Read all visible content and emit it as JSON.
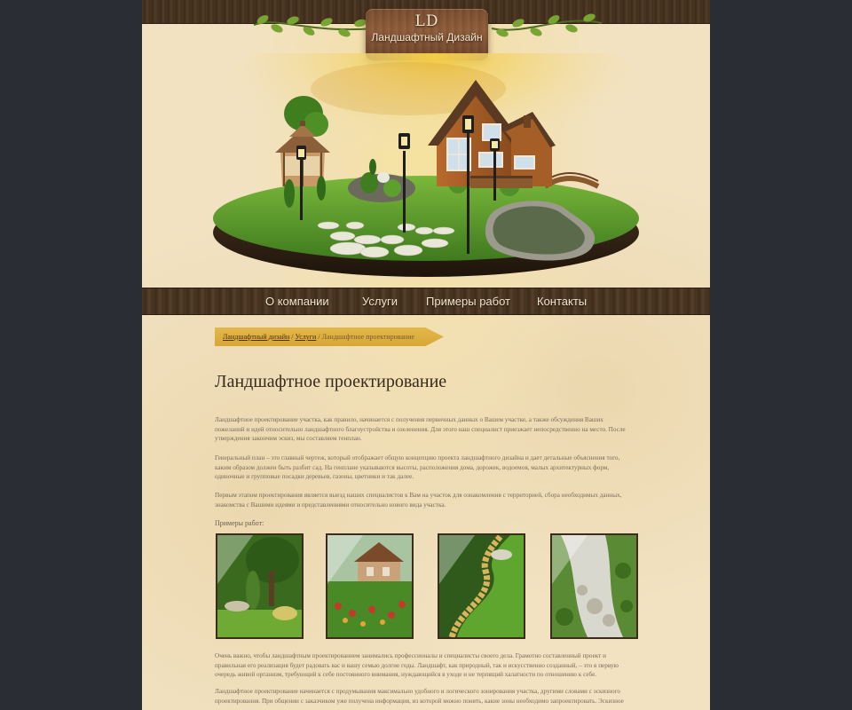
{
  "logo": {
    "mark": "LD",
    "text": "Ландшафтный Дизайн"
  },
  "nav": {
    "about": "О компании",
    "services": "Услуги",
    "works": "Примеры работ",
    "contacts": "Контакты"
  },
  "breadcrumb": {
    "home": "Ландшафтный дизайн",
    "services": "Услуги",
    "separator": "/",
    "current": "Ландшафтное проектирование"
  },
  "main": {
    "title": "Ландшафтное проектирование",
    "paragraphs": [
      "Ландшафтное проектирование участка, как правило, начинается с получения первичных данных о Вашем участке, а также обсуждения Ваших пожеланий и идей относительно ландшафтного благоустройства и озеленения. Для этого наш специалист приезжает непосредственно на место. После утверждения закончим эскиз, мы составляем генплан.",
      "Генеральный план – это главный чертеж, который отображает общую концепцию проекта ландшафтного дизайна и дает детальные объяснения того, каким образом должен быть разбит сад. На генплане указываются высоты, расположения дома, дорожек, водоемов, малых архитектурных форм, одиночные и групповые посадки деревьев, газоны, цветники и так далее.",
      "Первым этапом проектирования является выезд наших специалистов к Вам на участок для ознакомления с территорией, сбора необходимых данных, знакомства с Вашими идеями и представлениями относительно нового вида участка."
    ],
    "examples_label": "Примеры работ:",
    "bottom_paragraphs": [
      "Очень важно, чтобы ландшафтным проектированием занимались профессионалы и специалисты своего дела. Грамотно составленный проект и правильная его реализация будет радовать вас и вашу семью долгие годы. Ландшафт, как природный, так и искусственно созданный, – это в первую очередь живой организм, требующий к себе постоянного внимания, нуждающийся в уходе и не терпящий халатности по отношению к себе.",
      "Ландшафтное проектирование начинается с продумывания максимально удобного и логического зонирования участка, другими словами с эскизного проектирования. При общении с заказчиком уже получена информация, из которой можно понять, какие зоны необходимо запроектировать. Эскизное"
    ]
  },
  "colors": {
    "wood_dark": "#3e2c1c",
    "parchment": "#f2e2c1",
    "breadcrumb_gold": "#dcae3f",
    "grass": "#4e8a26"
  }
}
